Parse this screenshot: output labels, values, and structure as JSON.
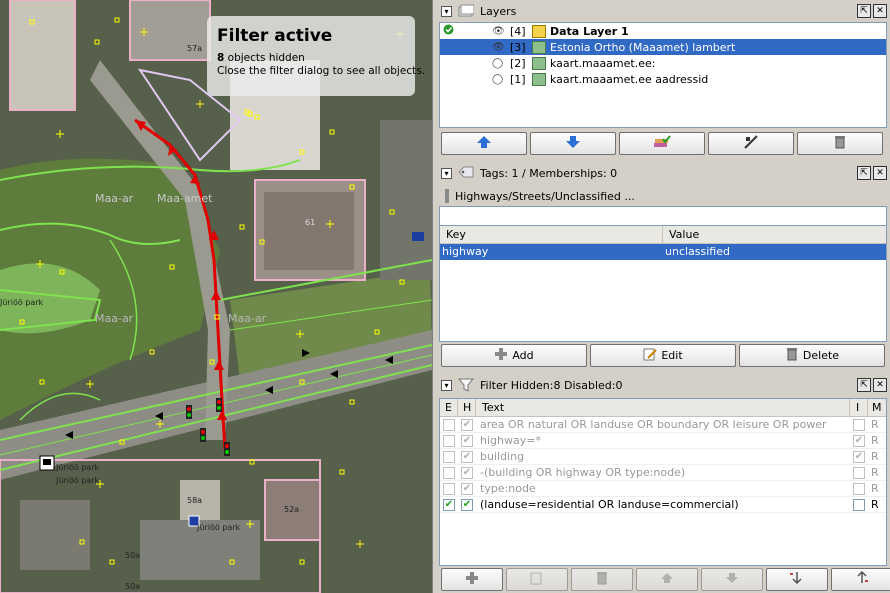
{
  "map": {
    "overlay": {
      "title": "Filter active",
      "hidden_count": "8",
      "hidden_suffix": " objects hidden",
      "hint": "Close the filter dialog to see all objects."
    },
    "labels": {
      "l1": "Maa-ar",
      "l2": "Maa-amet",
      "l3": "Maa-ar",
      "l4": "Maa-ar",
      "l5": "Jüriöö park",
      "l6": "Jüriöö park",
      "l7": "Jüriöö park",
      "l8": "57a",
      "l9": "61",
      "l10": "52a",
      "l11": "50a",
      "l12": "50a",
      "l13": "Jüriöö park",
      "l14": "58a"
    }
  },
  "layers": {
    "title": "Layers",
    "rows": [
      {
        "index": "[4]",
        "name": "Data Layer 1",
        "active": true,
        "visible": true,
        "selected": false,
        "bold": true
      },
      {
        "index": "[3]",
        "name": "Estonia Ortho (Maaamet) lambert",
        "active": false,
        "visible": true,
        "selected": true,
        "bold": false
      },
      {
        "index": "[2]",
        "name": "kaart.maaamet.ee:",
        "active": false,
        "visible": false,
        "selected": false,
        "bold": false
      },
      {
        "index": "[1]",
        "name": "kaart.maaamet.ee aadressid",
        "active": false,
        "visible": false,
        "selected": false,
        "bold": false
      }
    ],
    "toolbar": [
      "move-up-icon",
      "move-down-icon",
      "merge-layers-icon",
      "toggle-visibility-icon",
      "delete-layer-icon"
    ]
  },
  "tags": {
    "title": "Tags: 1 / Memberships: 0",
    "preset": "Highways/Streets/Unclassified ...",
    "col_key": "Key",
    "col_value": "Value",
    "rows": [
      {
        "key": "highway",
        "value": "unclassified"
      }
    ],
    "buttons": {
      "add": "Add",
      "edit": "Edit",
      "delete": "Delete"
    }
  },
  "filter": {
    "title": "Filter Hidden:8 Disabled:0",
    "col_e": "E",
    "col_h": "H",
    "col_text": "Text",
    "col_i": "I",
    "col_m": "M",
    "rows": [
      {
        "text": "area OR natural OR landuse OR boundary OR leisure OR power",
        "enabled": false,
        "hide": true,
        "inverted": false,
        "mode": "R"
      },
      {
        "text": "highway=*",
        "enabled": false,
        "hide": true,
        "inverted": true,
        "mode": "R"
      },
      {
        "text": "building",
        "enabled": false,
        "hide": true,
        "inverted": true,
        "mode": "R"
      },
      {
        "text": "-(building OR highway OR type:node)",
        "enabled": false,
        "hide": true,
        "inverted": false,
        "mode": "R"
      },
      {
        "text": "type:node",
        "enabled": false,
        "hide": true,
        "inverted": false,
        "mode": "R"
      },
      {
        "text": "(landuse=residential OR landuse=commercial)",
        "enabled": true,
        "hide": true,
        "inverted": false,
        "mode": "R"
      }
    ]
  },
  "colors": {
    "selection": "#316ac5",
    "route": "#e00000",
    "way": "#6fdc4a",
    "node": "#ffff00"
  }
}
